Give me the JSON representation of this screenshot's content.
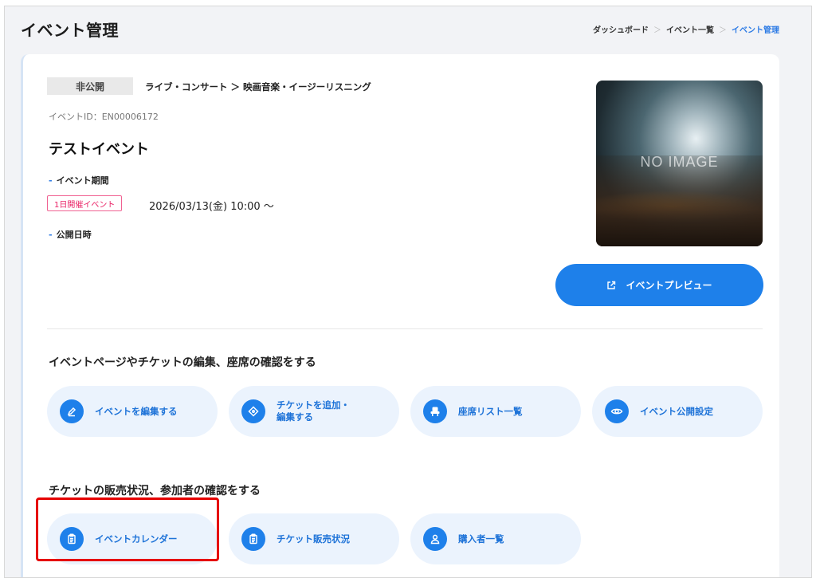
{
  "header": {
    "title": "イベント管理",
    "breadcrumb": [
      "ダッシュボード",
      "イベント一覧",
      "イベント管理"
    ]
  },
  "event": {
    "status": "非公開",
    "category": "ライブ・コンサート ＞ 映画音楽・イージーリスニング",
    "id_text": "イベントID：EN00006172",
    "name": "テストイベント",
    "period_label": "イベント期間",
    "oneday_badge": "1日開催イベント",
    "period_value": "2026/03/13(金) 10:00 ～",
    "publish_label": "公開日時",
    "image_text": "NO IMAGE"
  },
  "preview_button": {
    "label": "イベントプレビュー",
    "icon": "external-link-icon"
  },
  "sections": [
    {
      "title": "イベントページやチケットの編集、座席の確認をする",
      "buttons": [
        {
          "label": "イベントを編集する",
          "icon": "pencil-icon"
        },
        {
          "label": "チケットを追加・\n編集する",
          "icon": "ticket-tag-icon"
        },
        {
          "label": "座席リスト一覧",
          "icon": "seat-icon"
        },
        {
          "label": "イベント公開設定",
          "icon": "eye-icon"
        }
      ]
    },
    {
      "title": "チケットの販売状況、参加者の確認をする",
      "buttons": [
        {
          "label": "イベントカレンダー",
          "icon": "clipboard-icon"
        },
        {
          "label": "チケット販売状況",
          "icon": "clipboard-icon"
        },
        {
          "label": "購入者一覧",
          "icon": "user-icon"
        }
      ]
    }
  ],
  "colors": {
    "accent": "#1e80ea",
    "button_bg": "#ebf3fd",
    "badge_pink": "#e91e63",
    "highlight": "#e60000"
  }
}
